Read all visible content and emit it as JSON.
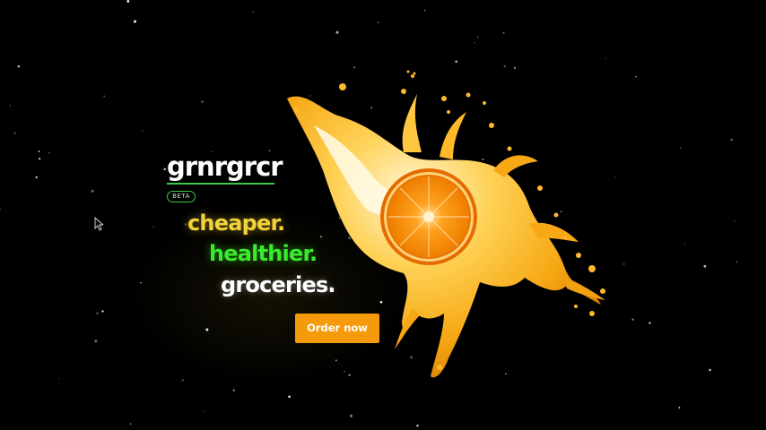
{
  "brand": {
    "logo_text": "grnrgrcr",
    "badge": "BETA",
    "accent_color": "#3ec84a"
  },
  "hero": {
    "taglines": [
      "cheaper.",
      "healthier.",
      "groceries."
    ],
    "tagline_colors": [
      "#f2d23a",
      "#3bea2e",
      "#ffffff"
    ],
    "cta_label": "Order now",
    "cta_color": "#f49a0b",
    "image": "orange-juice-splash"
  },
  "cursor": "mouse-pointer-icon"
}
